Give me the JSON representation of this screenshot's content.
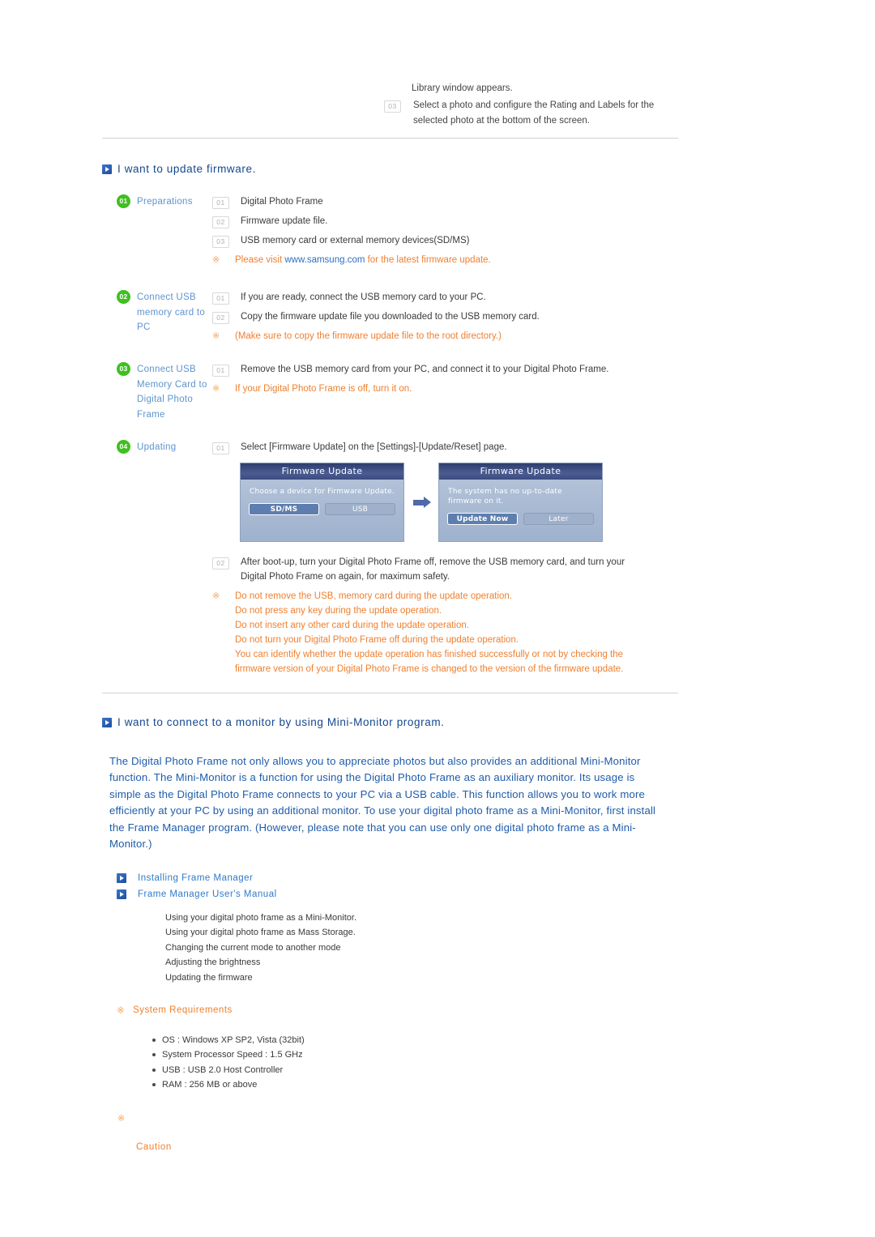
{
  "colors": {
    "heading_blue": "#14478f",
    "label_blue": "#5e94cd",
    "link_blue": "#2f7ac9",
    "orange": "#ef7f2e",
    "badge_green": "#3fbf20",
    "paragraph_blue": "#1f5caa"
  },
  "top_fragment": {
    "line1": "Library window appears.",
    "item": {
      "num": "03",
      "text": "Select a photo and configure the Rating and Labels for the selected photo at the bottom of the screen."
    }
  },
  "firmware_section": {
    "heading": "I want to update firmware.",
    "steps": [
      {
        "badge": "01",
        "label": "Preparations",
        "items": [
          {
            "num": "01",
            "text": "Digital Photo Frame"
          },
          {
            "num": "02",
            "text": "Firmware update file."
          },
          {
            "num": "03",
            "text": "USB memory card or external memory devices(SD/MS)"
          }
        ],
        "notes": [
          {
            "mark": "※",
            "pre": "Please visit ",
            "link": "www.samsung.com",
            "post": " for the latest firmware update."
          }
        ]
      },
      {
        "badge": "02",
        "label": "Connect USB memory card to PC",
        "items": [
          {
            "num": "01",
            "text": "If you are ready, connect the USB memory card to your PC."
          },
          {
            "num": "02",
            "text": "Copy the firmware update file you downloaded to the USB memory card."
          }
        ],
        "notes": [
          {
            "mark": "※",
            "pre": "(Make sure to copy the firmware update file to the root directory.)",
            "link": "",
            "post": ""
          }
        ]
      },
      {
        "badge": "03",
        "label": "Connect USB Memory Card to Digital Photo Frame",
        "items": [
          {
            "num": "01",
            "text": "Remove the USB memory card from your PC, and connect it to your Digital Photo Frame."
          }
        ],
        "notes": [
          {
            "mark": "※",
            "pre": "If your Digital Photo Frame is off, turn it on.",
            "link": "",
            "post": ""
          }
        ]
      },
      {
        "badge": "04",
        "label": "Updating",
        "items": [
          {
            "num": "01",
            "text": "Select [Firmware Update] on the [Settings]-[Update/Reset] page."
          }
        ],
        "notes": []
      }
    ],
    "dialogs": [
      {
        "title": "Firmware Update",
        "message": "Choose a device for Firmware Update.",
        "buttons": [
          {
            "label": "SD/MS",
            "selected": true
          },
          {
            "label": "USB",
            "selected": false
          }
        ]
      },
      {
        "title": "Firmware Update",
        "message": "The system has no up-to-date firmware on it.",
        "buttons": [
          {
            "label": "Update Now",
            "selected": true
          },
          {
            "label": "Later",
            "selected": false
          }
        ]
      }
    ],
    "after_dialog_item": {
      "num": "02",
      "text": "After boot-up, turn your Digital Photo Frame off, remove the USB memory card, and turn your Digital Photo Frame on again, for maximum safety."
    },
    "warnings": {
      "mark": "※",
      "lines": [
        "Do not remove the USB, memory card during the update operation.",
        "Do not press any key during the update operation.",
        "Do not insert any other card during the update operation.",
        "Do not turn your Digital Photo Frame off during the update operation.",
        "You can identify whether the update operation has finished successfully or not by checking the",
        "firmware version of your Digital Photo Frame is changed to the version of the firmware update."
      ]
    }
  },
  "mini_monitor_section": {
    "heading": "I want to connect to a monitor by using Mini-Monitor program.",
    "paragraph": "The Digital Photo Frame not only allows you to appreciate photos but also provides an additional Mini-Monitor function. The Mini-Monitor is a function for using the Digital Photo Frame as an auxiliary monitor. Its usage is simple as the Digital Photo Frame connects to your PC via a USB cable. This function allows you to work more efficiently at your PC by using an additional monitor. To use your digital photo frame as a Mini-Monitor, first install the Frame Manager program. (However, please note that you can use only one digital photo frame as a Mini-Monitor.)",
    "links": [
      "Installing Frame Manager",
      "Frame Manager User's Manual"
    ],
    "sublist": [
      "Using your digital photo frame as a Mini-Monitor.",
      "Using your digital photo frame as Mass Storage.",
      "Changing the current mode to another mode",
      "Adjusting the brightness",
      "Updating the firmware"
    ],
    "sysreq": {
      "mark": "※",
      "title": "System Requirements",
      "items": [
        "OS : Windows XP SP2, Vista (32bit)",
        "System Processor Speed : 1.5 GHz",
        "USB : USB 2.0 Host Controller",
        "RAM : 256 MB or above"
      ]
    },
    "caution": {
      "mark": "※",
      "label": "Caution"
    }
  }
}
